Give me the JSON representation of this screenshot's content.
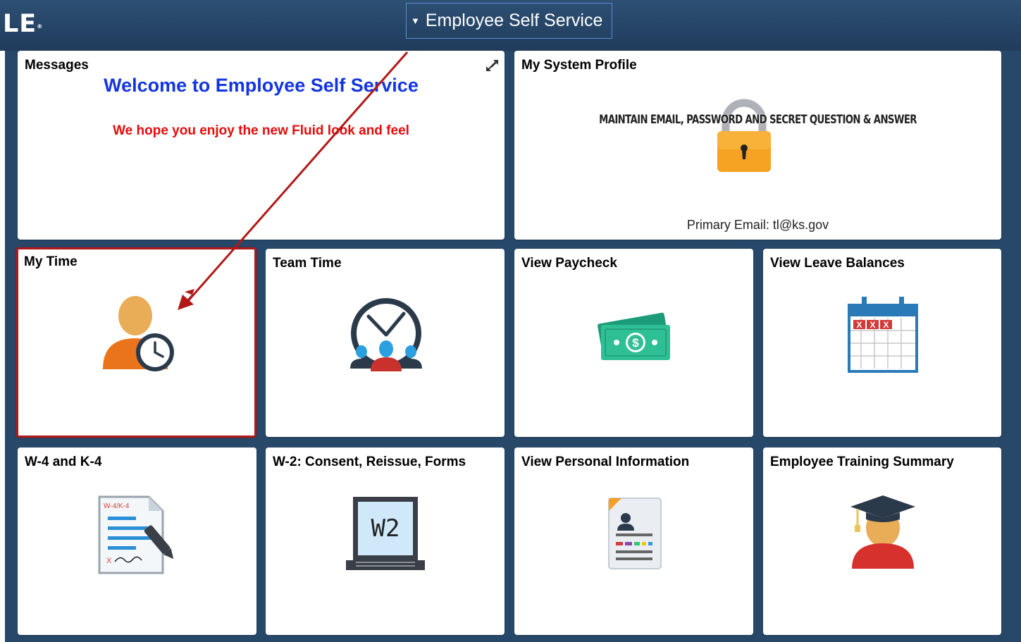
{
  "header": {
    "logo_text": "LE",
    "logo_mark": "®",
    "homepage_title": "Employee Self Service",
    "caret_icon": "caret-down-icon"
  },
  "messages_tile": {
    "title": "Messages",
    "welcome": "Welcome to Employee Self Service",
    "subtext": "We hope you enjoy the new Fluid look and feel",
    "expand_icon": "expand-icon",
    "welcome_color": "#1335e0",
    "subtext_color": "#e50b0b"
  },
  "profile_tile": {
    "title": "My System Profile",
    "banner": "MAINTAIN EMAIL, PASSWORD AND SECRET QUESTION & ANSWER",
    "email_text": "Primary Email: tl@ks.gov",
    "icon": "padlock-icon"
  },
  "tiles": [
    {
      "title": "My Time",
      "icon": "person-clock-icon",
      "highlighted": true
    },
    {
      "title": "Team Time",
      "icon": "team-clock-icon"
    },
    {
      "title": "View Paycheck",
      "icon": "money-icon"
    },
    {
      "title": "View Leave Balances",
      "icon": "calendar-icon",
      "calendar_marks": "XXX"
    },
    {
      "title": "W-4 and K-4",
      "icon": "tax-form-pen-icon",
      "form_label": "W-4/K-4",
      "sign_mark": "X"
    },
    {
      "title": "W-2: Consent, Reissue, Forms",
      "icon": "laptop-w2-icon",
      "screen_label": "W2"
    },
    {
      "title": "View Personal Information",
      "icon": "id-card-icon"
    },
    {
      "title": "Employee Training Summary",
      "icon": "graduate-icon"
    }
  ],
  "colors": {
    "header_bg": "#264567",
    "page_bg": "#284869",
    "highlight_border": "#b21818",
    "annotation_arrow": "#b21818"
  }
}
